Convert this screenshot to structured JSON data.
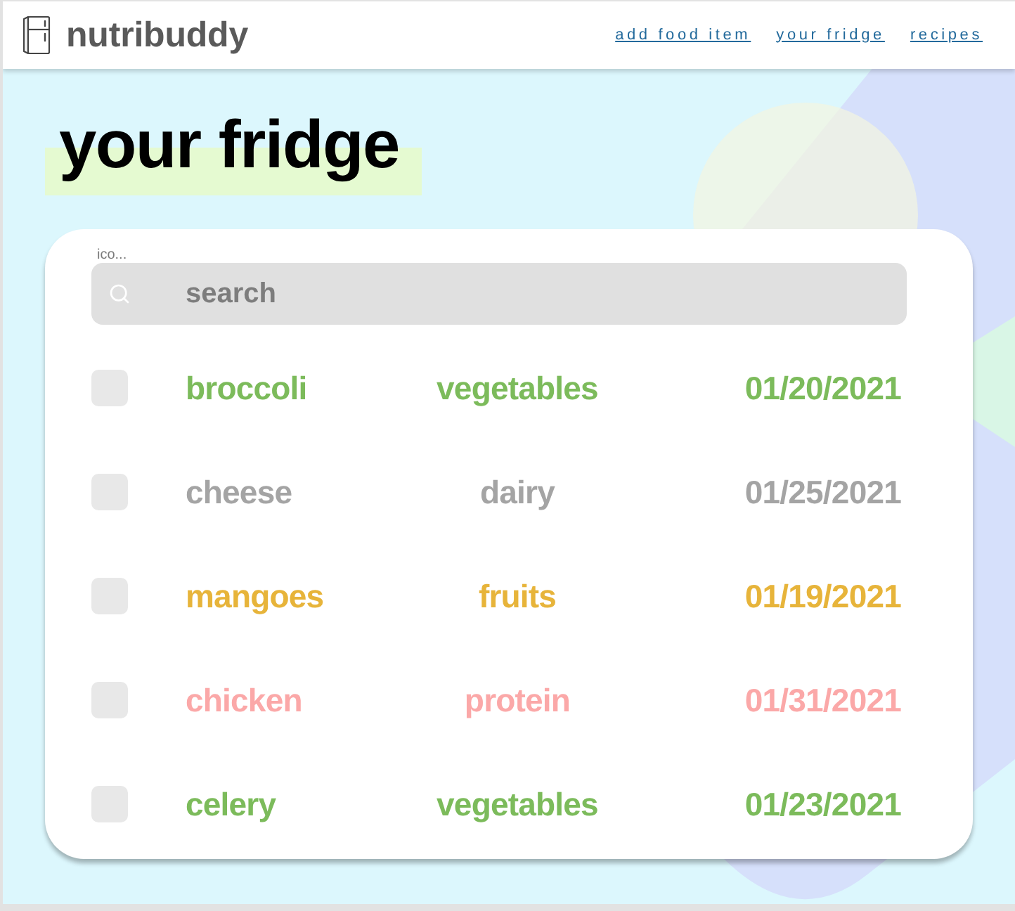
{
  "header": {
    "logo": "nutribuddy",
    "nav": [
      {
        "label": "add food item"
      },
      {
        "label": "your fridge"
      },
      {
        "label": "recipes"
      }
    ]
  },
  "page_title": "your fridge",
  "fridge": {
    "icon_alt": "ico...",
    "search": {
      "placeholder": "search"
    },
    "items": [
      {
        "name": "broccoli",
        "category": "vegetables",
        "date": "01/20/2021",
        "color": "#7cbb5b",
        "checked": false
      },
      {
        "name": "cheese",
        "category": "dairy",
        "date": "01/25/2021",
        "color": "#a4a4a4",
        "checked": false
      },
      {
        "name": "mangoes",
        "category": "fruits",
        "date": "01/19/2021",
        "color": "#e7b43a",
        "checked": false
      },
      {
        "name": "chicken",
        "category": "protein",
        "date": "01/31/2021",
        "color": "#fba8a8",
        "checked": false
      },
      {
        "name": "celery",
        "category": "vegetables",
        "date": "01/23/2021",
        "color": "#7cbb5b",
        "checked": false
      }
    ]
  }
}
